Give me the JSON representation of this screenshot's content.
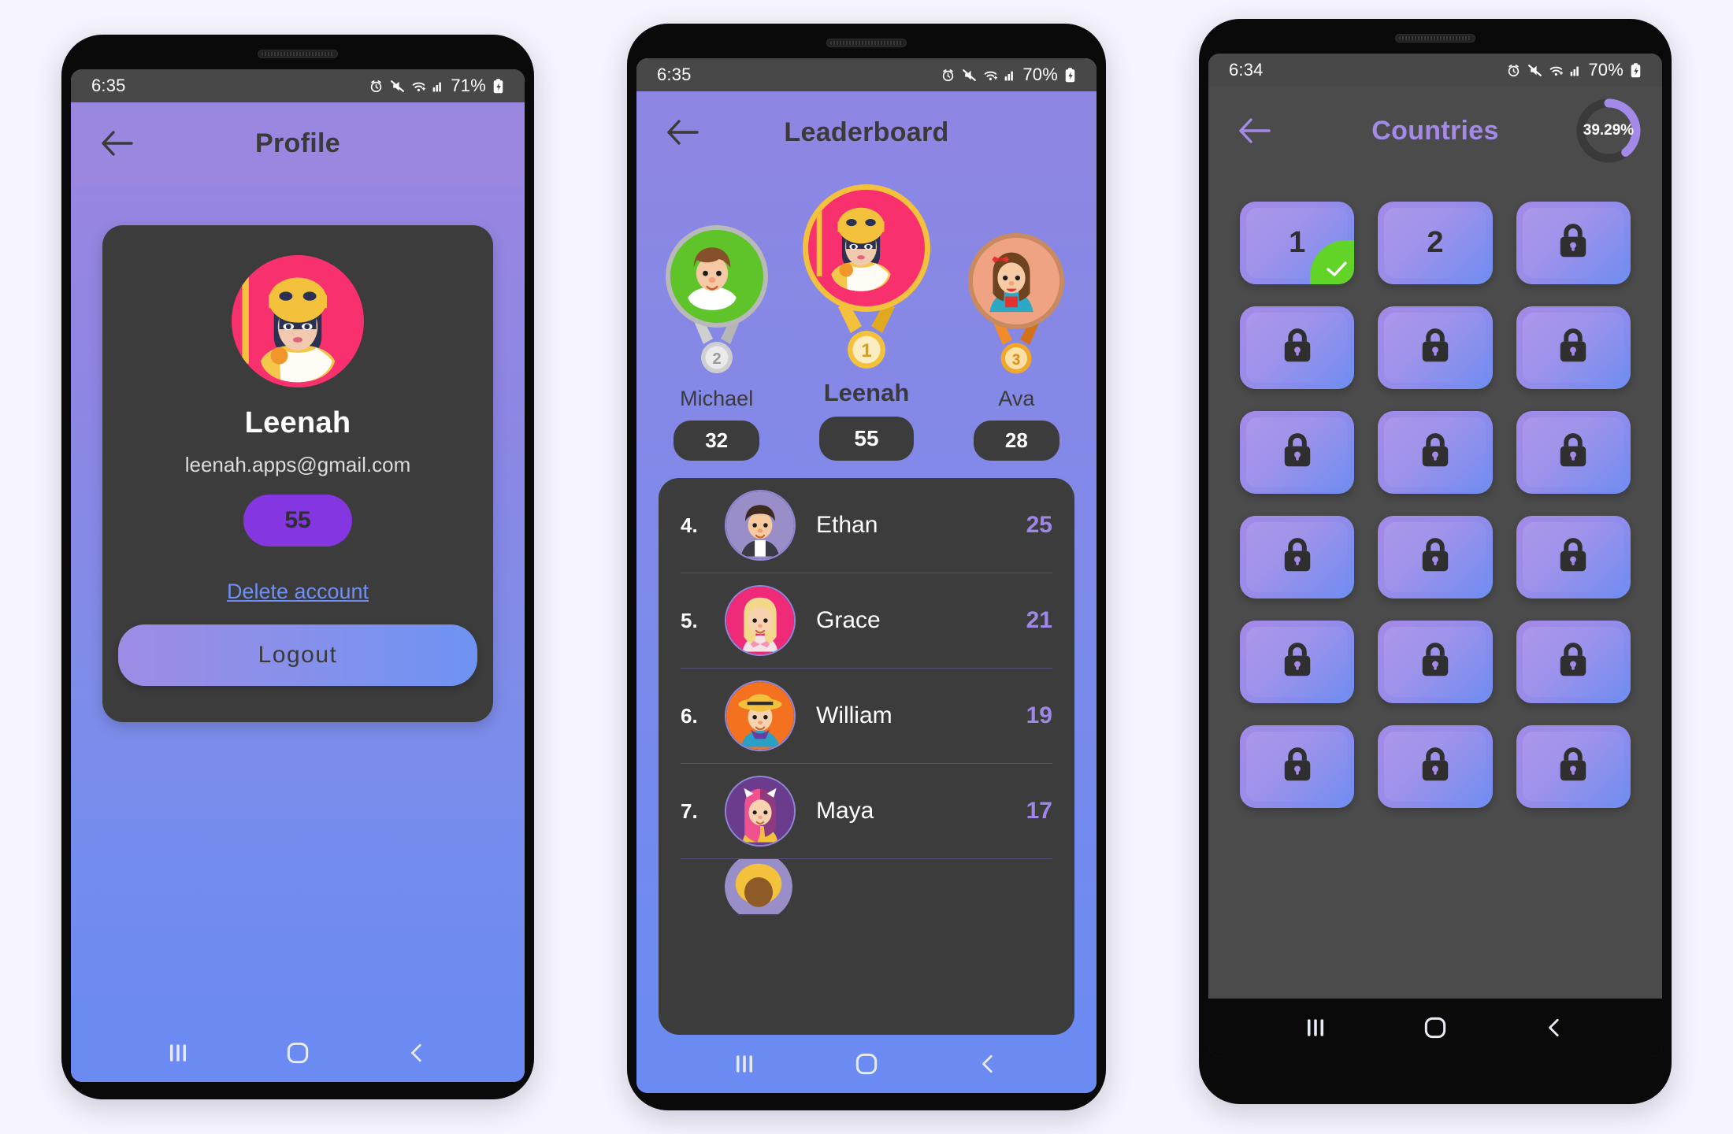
{
  "colors": {
    "accent_purple": "#8436e0",
    "link_blue": "#6f8ff5",
    "card_dark": "#3c3c3c",
    "statusbar": "#484848",
    "lavender": "#a48ae8",
    "tick_green": "#62d327",
    "gold": "#f3c13b",
    "silver": "#b9b9b9",
    "bronze": "#c98a60"
  },
  "phone1": {
    "statusbar": {
      "time": "6:35",
      "battery_pct": "71%",
      "icons": [
        "alarm-icon",
        "mute-icon",
        "wifi-icon",
        "signal-icon",
        "battery-charging-icon"
      ]
    },
    "appbar": {
      "title": "Profile",
      "back_icon": "back-arrow-icon"
    },
    "card": {
      "avatar": "avatar-leenah",
      "name": "Leenah",
      "email": "leenah.apps@gmail.com",
      "score": "55",
      "delete_label": "Delete account",
      "logout_label": "Logout"
    },
    "navbar": {
      "recents": "recents-icon",
      "home": "home-icon",
      "back": "back-icon"
    }
  },
  "phone2": {
    "statusbar": {
      "time": "6:35",
      "battery_pct": "70%",
      "icons": [
        "alarm-icon",
        "mute-icon",
        "wifi-icon",
        "signal-icon",
        "battery-charging-icon"
      ]
    },
    "appbar": {
      "title": "Leaderboard",
      "back_icon": "back-arrow-icon"
    },
    "podium": [
      {
        "rank": "2",
        "name": "Michael",
        "score": "32",
        "medal": "silver-medal-icon"
      },
      {
        "rank": "1",
        "name": "Leenah",
        "score": "55",
        "medal": "gold-medal-icon"
      },
      {
        "rank": "3",
        "name": "Ava",
        "score": "28",
        "medal": "bronze-medal-icon"
      }
    ],
    "list": [
      {
        "rank": "4.",
        "name": "Ethan",
        "score": "25"
      },
      {
        "rank": "5.",
        "name": "Grace",
        "score": "21"
      },
      {
        "rank": "6.",
        "name": "William",
        "score": "19"
      },
      {
        "rank": "7.",
        "name": "Maya",
        "score": "17"
      }
    ],
    "navbar": {
      "recents": "recents-icon",
      "home": "home-icon",
      "back": "back-icon"
    }
  },
  "phone3": {
    "statusbar": {
      "time": "6:34",
      "battery_pct": "70%",
      "icons": [
        "alarm-icon",
        "mute-icon",
        "wifi-icon",
        "signal-icon",
        "battery-charging-icon"
      ]
    },
    "appbar": {
      "title": "Countries",
      "back_icon": "back-arrow-icon",
      "progress_label": "39.29%",
      "progress_value": 39.29
    },
    "tiles": [
      {
        "label": "1",
        "state": "completed"
      },
      {
        "label": "2",
        "state": "unlocked"
      },
      {
        "label": "",
        "state": "locked"
      },
      {
        "label": "",
        "state": "locked"
      },
      {
        "label": "",
        "state": "locked"
      },
      {
        "label": "",
        "state": "locked"
      },
      {
        "label": "",
        "state": "locked"
      },
      {
        "label": "",
        "state": "locked"
      },
      {
        "label": "",
        "state": "locked"
      },
      {
        "label": "",
        "state": "locked"
      },
      {
        "label": "",
        "state": "locked"
      },
      {
        "label": "",
        "state": "locked"
      },
      {
        "label": "",
        "state": "locked"
      },
      {
        "label": "",
        "state": "locked"
      },
      {
        "label": "",
        "state": "locked"
      },
      {
        "label": "",
        "state": "locked"
      },
      {
        "label": "",
        "state": "locked"
      },
      {
        "label": "",
        "state": "locked"
      }
    ],
    "navbar": {
      "recents": "recents-icon",
      "home": "home-icon",
      "back": "back-icon"
    }
  }
}
